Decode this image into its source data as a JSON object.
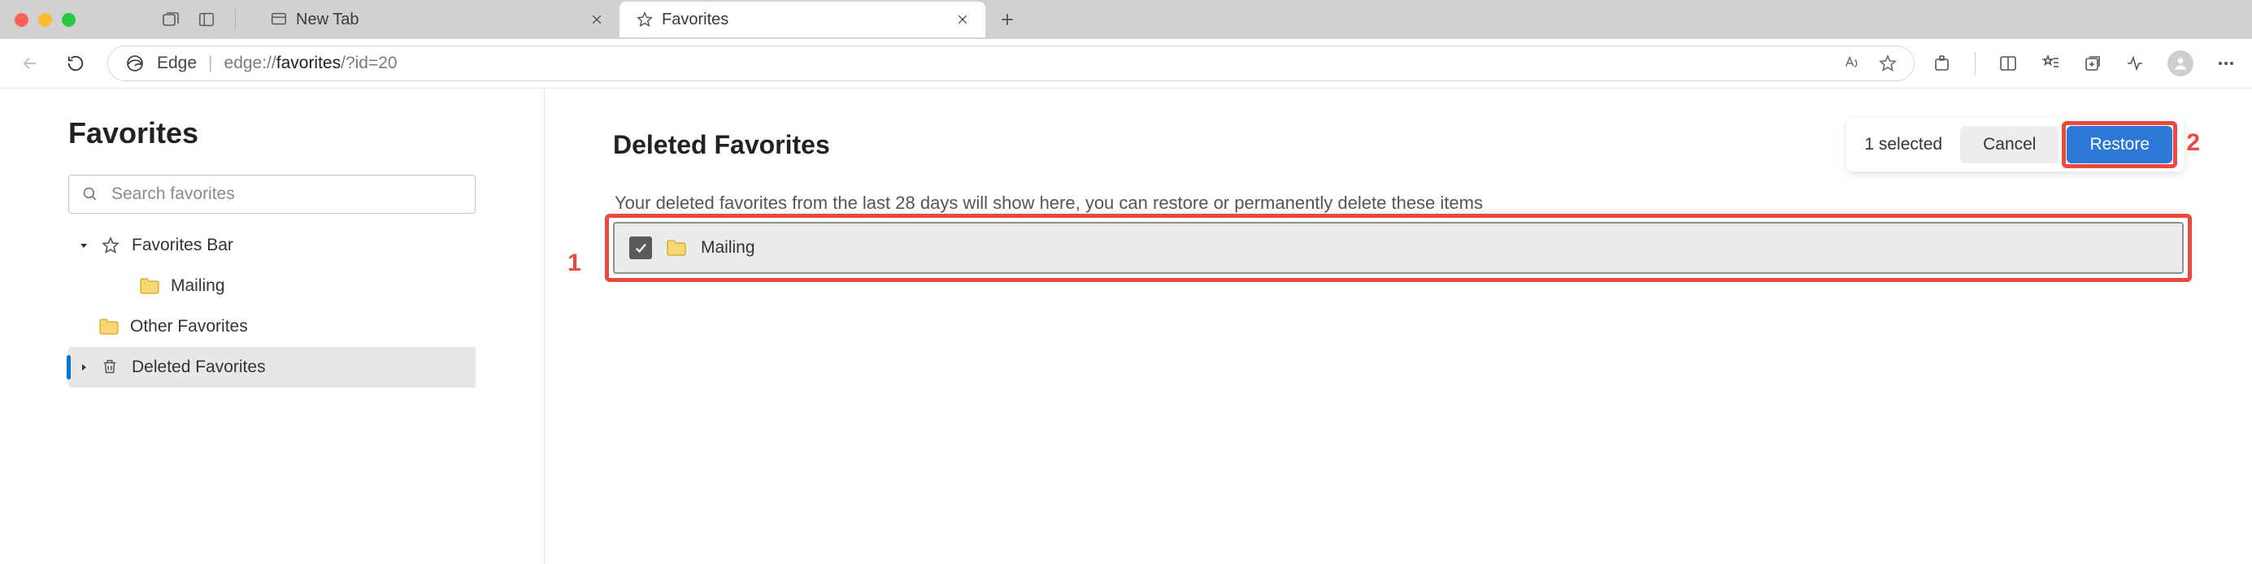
{
  "window": {
    "tabs": [
      {
        "name": "new-tab",
        "title": "New Tab",
        "active": false,
        "icon": "page-icon"
      },
      {
        "name": "favorites",
        "title": "Favorites",
        "active": true,
        "icon": "star-icon"
      }
    ]
  },
  "toolbar": {
    "brand": "Edge",
    "url_prefix": "edge://",
    "url_bold": "favorites",
    "url_suffix": "/?id=20"
  },
  "sidebar": {
    "title": "Favorites",
    "search_placeholder": "Search favorites",
    "items": [
      {
        "name": "favorites-bar",
        "label": "Favorites Bar",
        "icon": "star",
        "chevron": "down",
        "indent": 0
      },
      {
        "name": "mailing",
        "label": "Mailing",
        "icon": "folder",
        "chevron": "",
        "indent": 1
      },
      {
        "name": "other",
        "label": "Other Favorites",
        "icon": "folder",
        "chevron": "",
        "indent": 0
      },
      {
        "name": "deleted",
        "label": "Deleted Favorites",
        "icon": "trash",
        "chevron": "right",
        "indent": 0,
        "selected": true
      }
    ]
  },
  "main": {
    "title": "Deleted Favorites",
    "selected_text": "1 selected",
    "cancel_label": "Cancel",
    "restore_label": "Restore",
    "subtext": "Your deleted favorites from the last 28 days will show here, you can restore or permanently delete these items",
    "row": {
      "name": "Mailing",
      "checked": true
    }
  },
  "annotations": {
    "row_label": "1",
    "restore_label": "2"
  }
}
